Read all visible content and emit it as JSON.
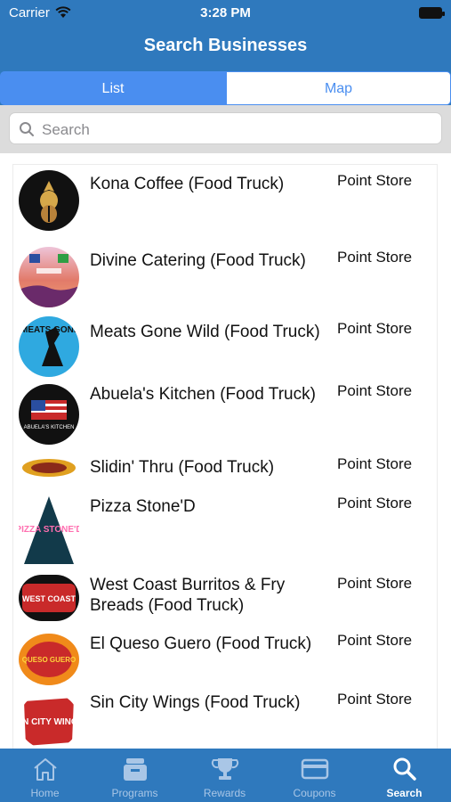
{
  "status_bar": {
    "carrier": "Carrier",
    "time": "3:28 PM"
  },
  "header": {
    "title": "Search Businesses"
  },
  "segments": {
    "list": "List",
    "map": "Map",
    "selected": "List"
  },
  "search": {
    "placeholder": "Search"
  },
  "businesses": [
    {
      "name": "Kona Coffee (Food Truck)",
      "type": "Point Store"
    },
    {
      "name": "Divine Catering (Food Truck)",
      "type": "Point Store"
    },
    {
      "name": "Meats Gone Wild (Food Truck)",
      "type": "Point Store"
    },
    {
      "name": "Abuela's Kitchen (Food Truck)",
      "type": "Point Store"
    },
    {
      "name": "Slidin' Thru (Food Truck)",
      "type": "Point Store"
    },
    {
      "name": "Pizza Stone'D",
      "type": "Point Store"
    },
    {
      "name": "West Coast Burritos & Fry Breads (Food Truck)",
      "type": "Point Store"
    },
    {
      "name": "El Queso Guero (Food Truck)",
      "type": "Point Store"
    },
    {
      "name": "Sin City Wings (Food Truck)",
      "type": "Point Store"
    }
  ],
  "tabbar": {
    "home": "Home",
    "programs": "Programs",
    "rewards": "Rewards",
    "coupons": "Coupons",
    "search": "Search",
    "active": "Search"
  },
  "colors": {
    "brand_blue": "#2f79bd",
    "segment_blue": "#4a8ef0"
  },
  "logo_texts": {
    "meats_gone_wild": "MEATS GONE WILD",
    "abuelas_kitchen": "ABUELA'S KITCHEN",
    "pizza_stoned": "PIZZA STONE'D",
    "west_coast": "WEST COAST",
    "queso_guero": "QUESO GUERO",
    "sin_city_wings": "SIN CITY WINGS"
  }
}
